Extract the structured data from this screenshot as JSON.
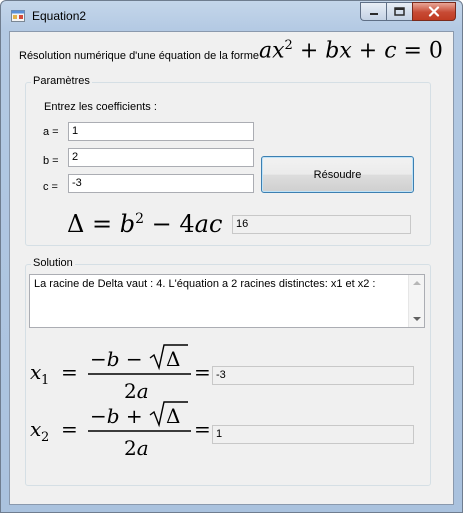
{
  "window": {
    "title": "Equation2"
  },
  "header": {
    "label": "Résolution numérique d'une équation de la forme",
    "formula_image": "a x² + b x + c = 0"
  },
  "params": {
    "group_title": "Paramètres",
    "prompt": "Entrez les coefficients :",
    "a_label": "a =",
    "b_label": "b =",
    "c_label": "c =",
    "a_value": "1",
    "b_value": "2",
    "c_value": "-3",
    "solve_button": "Résoudre",
    "delta_formula_image": "Δ = b² − 4ac =",
    "delta_value": "16"
  },
  "solution": {
    "group_title": "Solution",
    "message": "La racine de Delta vaut : 4. L'équation a 2 racines distinctes: x1 et x2 :",
    "x1_formula_image": "x₁ = (−b − √Δ) / 2a =",
    "x2_formula_image": "x₂ = (−b + √Δ) / 2a =",
    "x1_value": "-3",
    "x2_value": "1"
  },
  "icons": [
    "app-icon",
    "minimize-icon",
    "maximize-icon",
    "close-icon",
    "scroll-up-icon",
    "scroll-down-icon"
  ]
}
